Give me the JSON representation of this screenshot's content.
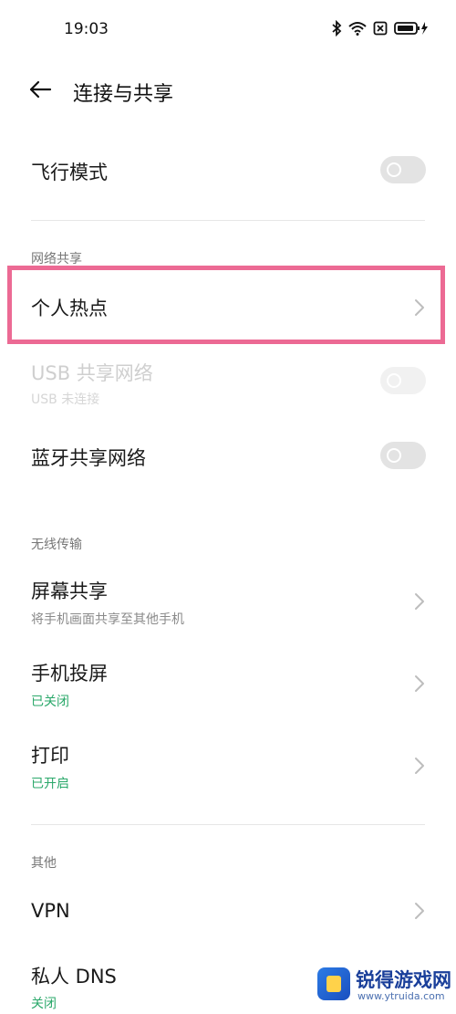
{
  "status_bar": {
    "time": "19:03",
    "icons": [
      "bluetooth-icon",
      "wifi-icon",
      "sim-off-icon",
      "battery-charging-icon"
    ]
  },
  "header": {
    "back_icon": "arrow-left-icon",
    "title": "连接与共享"
  },
  "airplane_mode": {
    "label": "飞行模式",
    "enabled": false
  },
  "network_sharing": {
    "section_label": "网络共享",
    "hotspot": {
      "label": "个人热点",
      "highlighted": true,
      "highlight_color": "#ec6a94"
    },
    "usb": {
      "label": "USB 共享网络",
      "subtitle": "USB 未连接",
      "enabled": false,
      "disabled": true
    },
    "bluetooth": {
      "label": "蓝牙共享网络",
      "enabled": false
    }
  },
  "wireless": {
    "section_label": "无线传输",
    "screen_share": {
      "label": "屏幕共享",
      "subtitle": "将手机画面共享至其他手机"
    },
    "cast": {
      "label": "手机投屏",
      "status": "已关闭"
    },
    "print": {
      "label": "打印",
      "status": "已开启"
    }
  },
  "other": {
    "section_label": "其他",
    "vpn": {
      "label": "VPN"
    },
    "private_dns": {
      "label": "私人 DNS",
      "status": "关闭"
    }
  },
  "watermark": {
    "name": "锐得游戏网",
    "url": "www.ytruida.com"
  },
  "colors": {
    "accent_green": "#2aa86a",
    "toggle_off": "#e3e3e3",
    "highlight": "#ec6a94"
  }
}
